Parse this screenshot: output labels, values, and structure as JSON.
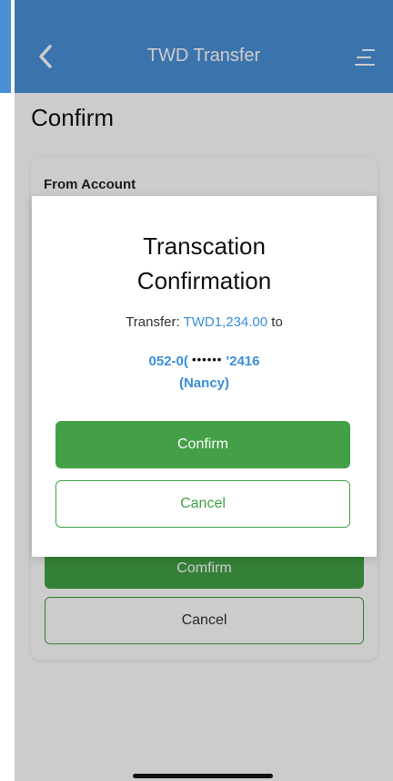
{
  "navbar": {
    "title": "TWD Transfer",
    "back_icon": "chevron-left-icon",
    "menu_icon": "menu-icon",
    "color": "#4a90d9"
  },
  "page": {
    "title": "Confirm",
    "from_account_label": "From Account",
    "confirm_label": "Comfirm",
    "cancel_label": "Cancel"
  },
  "dialog": {
    "title_line1": "Transcation",
    "title_line2": "Confirmation",
    "transfer_prefix": "Transfer:",
    "amount": "TWD1,234.00",
    "transfer_suffix": "to",
    "account_start": "052-0(",
    "account_masked": "••••••",
    "account_end": "'2416",
    "recipient_name": "(Nancy)",
    "confirm_label": "Confirm",
    "cancel_label": "Cancel"
  },
  "colors": {
    "accent_blue": "#3b8fd9",
    "primary_green": "#43a047"
  }
}
